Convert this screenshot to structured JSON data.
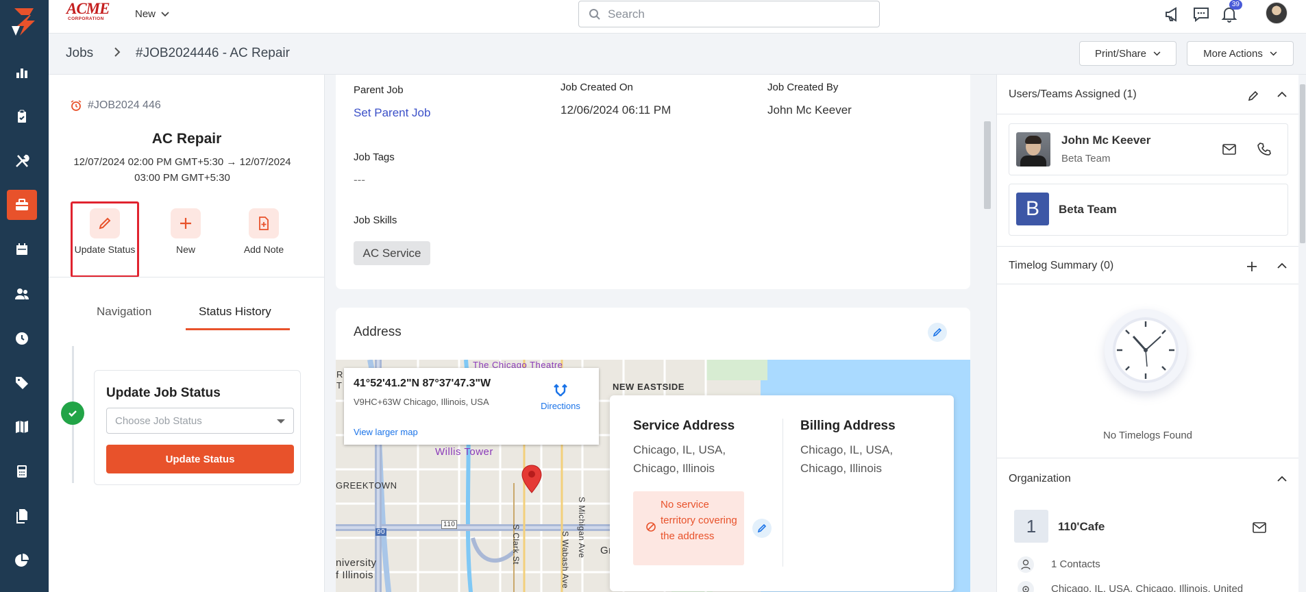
{
  "topbar": {
    "brand_name": "ACME",
    "brand_sub": "CORPORATION",
    "new_label": "New",
    "search_placeholder": "Search",
    "notification_count": "39"
  },
  "breadcrumb": {
    "root": "Jobs",
    "current": "#JOB2024446 - AC Repair",
    "print_share": "Print/Share",
    "more_actions": "More Actions"
  },
  "job": {
    "number": "#JOB2024 446",
    "title": "AC Repair",
    "dates": "12/07/2024 02:00 PM GMT+5:30 → 12/07/2024 03:00 PM GMT+5:30",
    "actions": {
      "update_status": "Update Status",
      "new": "New",
      "add_note": "Add Note"
    },
    "tabs": {
      "navigation": "Navigation",
      "status_history": "Status History"
    },
    "status_card": {
      "heading": "Update Job Status",
      "placeholder": "Choose Job Status",
      "button": "Update Status"
    }
  },
  "details": {
    "parent_job_label": "Parent Job",
    "parent_job_value": "Set Parent Job",
    "created_on_label": "Job Created On",
    "created_on_value": "12/06/2024 06:11 PM",
    "created_by_label": "Job Created By",
    "created_by_value": "John Mc Keever",
    "tags_label": "Job Tags",
    "tags_value": "---",
    "skills_label": "Job Skills",
    "skills_value": "AC Service"
  },
  "address": {
    "title": "Address",
    "map": {
      "coords": "41°52'41.2\"N 87°37'47.3\"W",
      "plus_code": "V9HC+63W Chicago, Illinois, USA",
      "directions": "Directions",
      "larger_map": "View larger map",
      "labels": {
        "chicago_theatre": "The Chicago Theatre",
        "new_eastside": "NEW EASTSIDE",
        "willis_tower": "Willis Tower",
        "greektown": "GREEKTOWN",
        "university": "niversity",
        "of_illinois": "f Illinois",
        "s_clark": "S Clark St",
        "s_wabash": "S Wabash Ave",
        "s_michigan": "S Michigan Ave",
        "route_90": "90",
        "route_110": "110",
        "left_r": "R",
        "left_t": "T",
        "gr": "Gr"
      }
    },
    "service_heading": "Service Address",
    "service_line1": "Chicago, IL, USA,",
    "service_line2": "Chicago, Illinois",
    "billing_heading": "Billing Address",
    "billing_line1": "Chicago, IL, USA,",
    "billing_line2": "Chicago, Illinois",
    "warning": "No service territory covering the address"
  },
  "right": {
    "users_heading": "Users/Teams Assigned (1)",
    "user_name": "John Mc Keever",
    "user_team": "Beta Team",
    "team_initial": "B",
    "team_name": "Beta Team",
    "timelog_heading": "Timelog Summary (0)",
    "timelog_empty": "No Timelogs Found",
    "org_heading": "Organization",
    "org_initial": "1",
    "org_name": "110'Cafe",
    "org_contacts": "1 Contacts",
    "org_address": "Chicago, IL, USA, Chicago, Illinois, United"
  },
  "colors": {
    "accent": "#e8522b",
    "sidebar": "#1f3a52",
    "link": "#3b50c8",
    "success": "#22a447"
  },
  "icons": {
    "sidebar": [
      "reports-icon",
      "clipboard-icon",
      "tools-icon",
      "briefcase-icon",
      "calendar-icon",
      "users-icon",
      "clock-icon",
      "tag-icon",
      "map-icon",
      "calculator-icon",
      "documents-icon",
      "pie-chart-icon"
    ]
  }
}
